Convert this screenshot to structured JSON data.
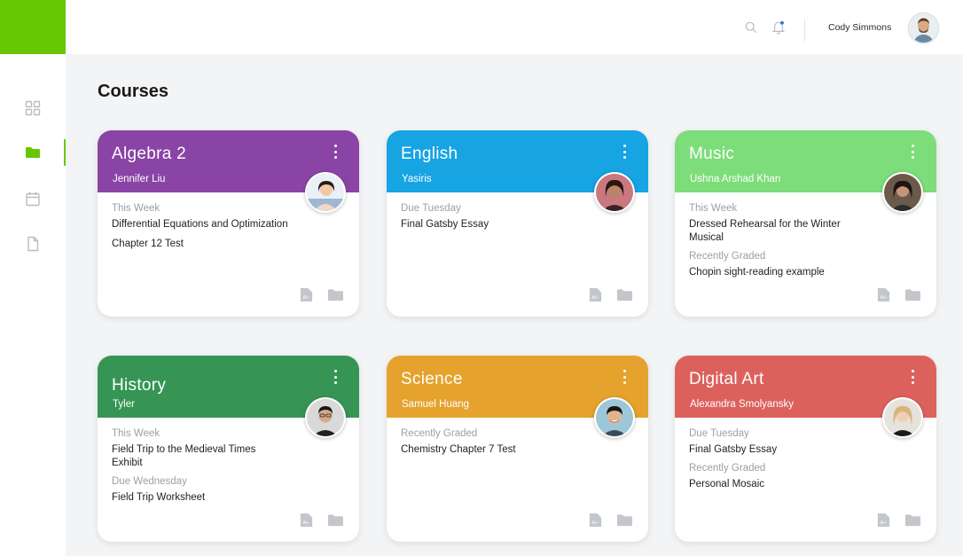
{
  "header": {
    "user_name": "Cody Simmons",
    "icons": [
      "search-icon",
      "bell-icon"
    ]
  },
  "sidebar": {
    "items": [
      {
        "name": "dashboard",
        "icon": "grid-icon",
        "active": false
      },
      {
        "name": "courses",
        "icon": "folder-icon",
        "active": true
      },
      {
        "name": "calendar",
        "icon": "calendar-icon",
        "active": false
      },
      {
        "name": "documents",
        "icon": "document-icon",
        "active": false
      }
    ],
    "accent": "#66c803"
  },
  "main": {
    "title": "Courses",
    "courses": [
      {
        "title": "Algebra 2",
        "teacher": "Jennifer Liu",
        "color": "#8a44a6",
        "sections": [
          {
            "label": "This Week",
            "items": [
              "Differential Equations and Optimization",
              "Chapter 12 Test"
            ]
          }
        ]
      },
      {
        "title": "English",
        "teacher": "Yasiris",
        "color": "#16a4e3",
        "sections": [
          {
            "label": "Due Tuesday",
            "items": [
              "Final Gatsby Essay"
            ]
          }
        ]
      },
      {
        "title": "Music",
        "teacher": "Ushna Arshad Khan",
        "color": "#7ddd7a",
        "sections": [
          {
            "label": "This Week",
            "items": [
              "Dressed Rehearsal for the Winter Musical"
            ]
          },
          {
            "label": "Recently Graded",
            "items": [
              "Chopin sight-reading example"
            ]
          }
        ]
      },
      {
        "title": "History",
        "teacher": "Tyler",
        "color": "#369555",
        "sections": [
          {
            "label": "This Week",
            "items": [
              "Field Trip to the Medieval Times Exhibit"
            ]
          },
          {
            "label": "Due Wednesday",
            "items": [
              "Field Trip Worksheet"
            ]
          }
        ]
      },
      {
        "title": "Science",
        "teacher": "Samuel Huang",
        "color": "#e5a22d",
        "sections": [
          {
            "label": "Recently Graded",
            "items": [
              "Chemistry Chapter 7 Test"
            ]
          }
        ]
      },
      {
        "title": "Digital Art",
        "teacher": "Alexandra Smolyansky",
        "color": "#dc615d",
        "sections": [
          {
            "label": "Due Tuesday",
            "items": [
              "Final Gatsby Essay"
            ]
          },
          {
            "label": "Recently Graded",
            "items": [
              "Personal Mosaic"
            ]
          }
        ]
      }
    ],
    "card_actions": [
      "grades-icon",
      "folder-icon"
    ]
  }
}
